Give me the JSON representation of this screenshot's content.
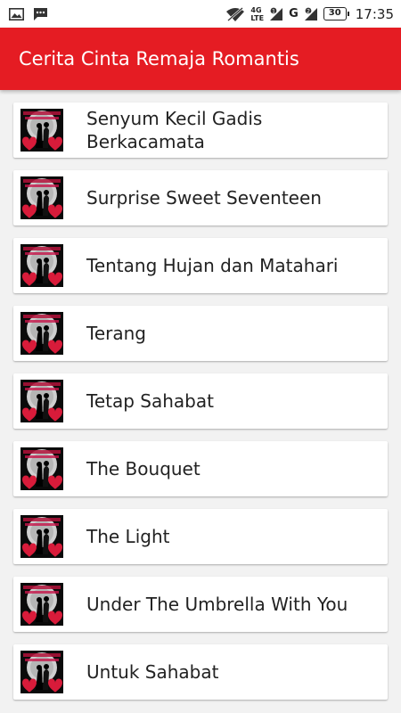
{
  "status_bar": {
    "network_top": "4G",
    "network_bottom": "LTE",
    "sim1": "1",
    "sim2": "2",
    "carrier_letter": "G",
    "battery": "30",
    "time": "17:35"
  },
  "app_bar": {
    "title": "Cerita Cinta Remaja Romantis",
    "color": "#e51c23"
  },
  "stories": [
    {
      "title": "Senyum Kecil Gadis Berkacamata"
    },
    {
      "title": "Surprise Sweet Seventeen"
    },
    {
      "title": "Tentang Hujan dan Matahari"
    },
    {
      "title": "Terang"
    },
    {
      "title": "Tetap Sahabat"
    },
    {
      "title": "The Bouquet"
    },
    {
      "title": "The Light"
    },
    {
      "title": "Under The Umbrella With You"
    },
    {
      "title": "Untuk Sahabat"
    }
  ]
}
